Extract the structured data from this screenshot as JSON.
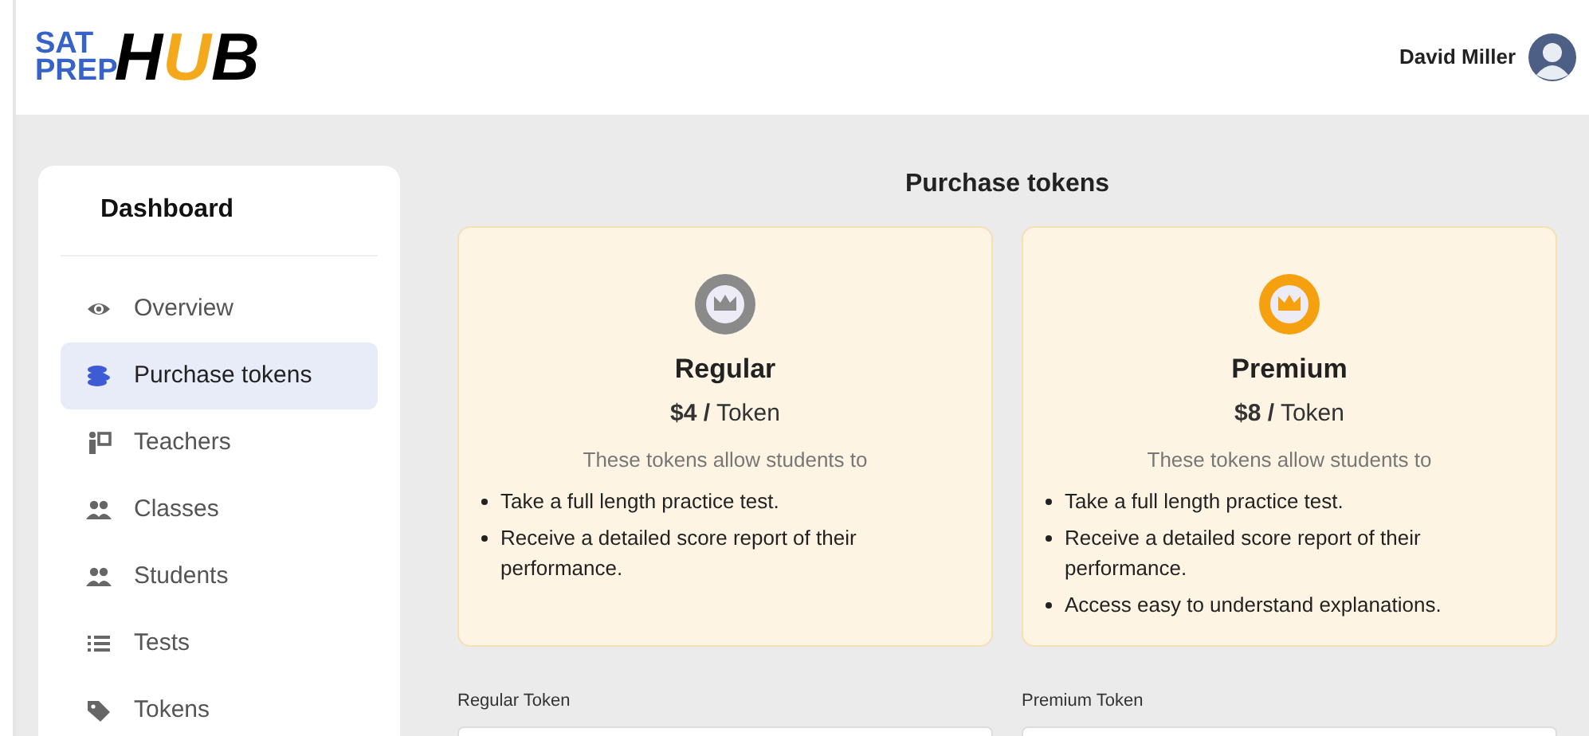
{
  "header": {
    "logo": {
      "line_1": "SAT",
      "line_2": "PREP",
      "word_start": "H",
      "word_middle": "U",
      "word_end": "B"
    },
    "user_name": "David Miller"
  },
  "sidebar": {
    "title": "Dashboard",
    "items": [
      {
        "label": "Overview",
        "selected": false
      },
      {
        "label": "Purchase tokens",
        "selected": true
      },
      {
        "label": "Teachers",
        "selected": false
      },
      {
        "label": "Classes",
        "selected": false
      },
      {
        "label": "Students",
        "selected": false
      },
      {
        "label": "Tests",
        "selected": false
      },
      {
        "label": "Tokens",
        "selected": false
      }
    ]
  },
  "main": {
    "title": "Purchase tokens",
    "plans": [
      {
        "name": "Regular",
        "color": "#8a8a8a",
        "price": "**$4 /** Token",
        "intro": "These tokens allow students to",
        "features": [
          "Take a full length practice test.",
          "Receive a detailed score report of their performance."
        ],
        "field_label": "Regular Token"
      },
      {
        "name": "Premium",
        "color": "#f5a00f",
        "price": "**$8 /** Token",
        "intro": "These tokens allow students to",
        "features": [
          "Take a full length practice test.",
          "Receive a detailed score report of their performance.",
          "Access easy to understand explanations."
        ],
        "field_label": "Premium Token"
      }
    ]
  }
}
